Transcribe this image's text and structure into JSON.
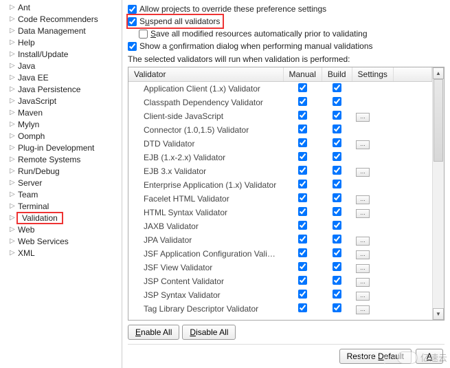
{
  "tree": {
    "items": [
      {
        "label": "Ant"
      },
      {
        "label": "Code Recommenders"
      },
      {
        "label": "Data Management"
      },
      {
        "label": "Help"
      },
      {
        "label": "Install/Update"
      },
      {
        "label": "Java"
      },
      {
        "label": "Java EE"
      },
      {
        "label": "Java Persistence"
      },
      {
        "label": "JavaScript"
      },
      {
        "label": "Maven"
      },
      {
        "label": "Mylyn"
      },
      {
        "label": "Oomph"
      },
      {
        "label": "Plug-in Development"
      },
      {
        "label": "Remote Systems"
      },
      {
        "label": "Run/Debug"
      },
      {
        "label": "Server"
      },
      {
        "label": "Team"
      },
      {
        "label": "Terminal"
      },
      {
        "label": "Validation",
        "current": true
      },
      {
        "label": "Web"
      },
      {
        "label": "Web Services"
      },
      {
        "label": "XML"
      }
    ]
  },
  "opts": {
    "allow_override": {
      "checked": true,
      "label": "Allow projects to override these preference settings"
    },
    "suspend": {
      "checked": true,
      "label_pre": "S",
      "label_mn": "u",
      "label_post": "spend all validators"
    },
    "save_modified": {
      "checked": false,
      "label_pre": "",
      "label_mn": "S",
      "label_post": "ave all modified resources automatically prior to validating"
    },
    "show_conf": {
      "checked": true,
      "label_pre": "Show a ",
      "label_mn": "c",
      "label_post": "onfirmation dialog when performing manual validations"
    }
  },
  "sel_text_pre": "The selected ",
  "sel_text_mn": "v",
  "sel_text_post": "alidators will run when validation is performed:",
  "cols": {
    "c1": "Validator",
    "c2": "Manual",
    "c3": "Build",
    "c4": "Settings"
  },
  "rows": [
    {
      "name": "Application Client (1.x) Validator",
      "manual": true,
      "build": true,
      "settings": false
    },
    {
      "name": "Classpath Dependency Validator",
      "manual": true,
      "build": true,
      "settings": false
    },
    {
      "name": "Client-side JavaScript",
      "manual": true,
      "build": true,
      "settings": true
    },
    {
      "name": "Connector (1.0,1.5) Validator",
      "manual": true,
      "build": true,
      "settings": false
    },
    {
      "name": "DTD Validator",
      "manual": true,
      "build": true,
      "settings": true
    },
    {
      "name": "EJB (1.x-2.x) Validator",
      "manual": true,
      "build": true,
      "settings": false
    },
    {
      "name": "EJB 3.x Validator",
      "manual": true,
      "build": true,
      "settings": true
    },
    {
      "name": "Enterprise Application (1.x) Validator",
      "manual": true,
      "build": true,
      "settings": false
    },
    {
      "name": "Facelet HTML Validator",
      "manual": true,
      "build": true,
      "settings": true
    },
    {
      "name": "HTML Syntax Validator",
      "manual": true,
      "build": true,
      "settings": true
    },
    {
      "name": "JAXB Validator",
      "manual": true,
      "build": true,
      "settings": false
    },
    {
      "name": "JPA Validator",
      "manual": true,
      "build": true,
      "settings": true
    },
    {
      "name": "JSF Application Configuration Valida...",
      "manual": true,
      "build": true,
      "settings": true
    },
    {
      "name": "JSF View Validator",
      "manual": true,
      "build": true,
      "settings": true
    },
    {
      "name": "JSP Content Validator",
      "manual": true,
      "build": true,
      "settings": true
    },
    {
      "name": "JSP Syntax Validator",
      "manual": true,
      "build": true,
      "settings": true
    },
    {
      "name": "Tag Library Descriptor Validator",
      "manual": true,
      "build": true,
      "settings": true
    }
  ],
  "buttons": {
    "enable_pre": "",
    "enable_mn": "E",
    "enable_post": "nable All",
    "disable_pre": "",
    "disable_mn": "D",
    "disable_post": "isable All",
    "restore_pre": "Restore ",
    "restore_mn": "D",
    "restore_post": "efault",
    "apply_pre": "",
    "apply_mn": "A",
    "apply_post": "pply"
  },
  "watermark": "亿速云",
  "faint": "http:"
}
